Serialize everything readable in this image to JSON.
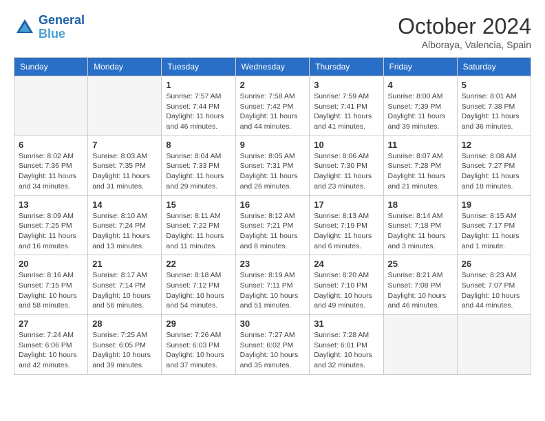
{
  "logo": {
    "line1": "General",
    "line2": "Blue"
  },
  "title": "October 2024",
  "location": "Alboraya, Valencia, Spain",
  "weekdays": [
    "Sunday",
    "Monday",
    "Tuesday",
    "Wednesday",
    "Thursday",
    "Friday",
    "Saturday"
  ],
  "weeks": [
    [
      {
        "day": null
      },
      {
        "day": null
      },
      {
        "day": "1",
        "sunrise": "7:57 AM",
        "sunset": "7:44 PM",
        "daylight": "11 hours and 46 minutes."
      },
      {
        "day": "2",
        "sunrise": "7:58 AM",
        "sunset": "7:42 PM",
        "daylight": "11 hours and 44 minutes."
      },
      {
        "day": "3",
        "sunrise": "7:59 AM",
        "sunset": "7:41 PM",
        "daylight": "11 hours and 41 minutes."
      },
      {
        "day": "4",
        "sunrise": "8:00 AM",
        "sunset": "7:39 PM",
        "daylight": "11 hours and 39 minutes."
      },
      {
        "day": "5",
        "sunrise": "8:01 AM",
        "sunset": "7:38 PM",
        "daylight": "11 hours and 36 minutes."
      }
    ],
    [
      {
        "day": "6",
        "sunrise": "8:02 AM",
        "sunset": "7:36 PM",
        "daylight": "11 hours and 34 minutes."
      },
      {
        "day": "7",
        "sunrise": "8:03 AM",
        "sunset": "7:35 PM",
        "daylight": "11 hours and 31 minutes."
      },
      {
        "day": "8",
        "sunrise": "8:04 AM",
        "sunset": "7:33 PM",
        "daylight": "11 hours and 29 minutes."
      },
      {
        "day": "9",
        "sunrise": "8:05 AM",
        "sunset": "7:31 PM",
        "daylight": "11 hours and 26 minutes."
      },
      {
        "day": "10",
        "sunrise": "8:06 AM",
        "sunset": "7:30 PM",
        "daylight": "11 hours and 23 minutes."
      },
      {
        "day": "11",
        "sunrise": "8:07 AM",
        "sunset": "7:28 PM",
        "daylight": "11 hours and 21 minutes."
      },
      {
        "day": "12",
        "sunrise": "8:08 AM",
        "sunset": "7:27 PM",
        "daylight": "11 hours and 18 minutes."
      }
    ],
    [
      {
        "day": "13",
        "sunrise": "8:09 AM",
        "sunset": "7:25 PM",
        "daylight": "11 hours and 16 minutes."
      },
      {
        "day": "14",
        "sunrise": "8:10 AM",
        "sunset": "7:24 PM",
        "daylight": "11 hours and 13 minutes."
      },
      {
        "day": "15",
        "sunrise": "8:11 AM",
        "sunset": "7:22 PM",
        "daylight": "11 hours and 11 minutes."
      },
      {
        "day": "16",
        "sunrise": "8:12 AM",
        "sunset": "7:21 PM",
        "daylight": "11 hours and 8 minutes."
      },
      {
        "day": "17",
        "sunrise": "8:13 AM",
        "sunset": "7:19 PM",
        "daylight": "11 hours and 6 minutes."
      },
      {
        "day": "18",
        "sunrise": "8:14 AM",
        "sunset": "7:18 PM",
        "daylight": "11 hours and 3 minutes."
      },
      {
        "day": "19",
        "sunrise": "8:15 AM",
        "sunset": "7:17 PM",
        "daylight": "11 hours and 1 minute."
      }
    ],
    [
      {
        "day": "20",
        "sunrise": "8:16 AM",
        "sunset": "7:15 PM",
        "daylight": "10 hours and 58 minutes."
      },
      {
        "day": "21",
        "sunrise": "8:17 AM",
        "sunset": "7:14 PM",
        "daylight": "10 hours and 56 minutes."
      },
      {
        "day": "22",
        "sunrise": "8:18 AM",
        "sunset": "7:12 PM",
        "daylight": "10 hours and 54 minutes."
      },
      {
        "day": "23",
        "sunrise": "8:19 AM",
        "sunset": "7:11 PM",
        "daylight": "10 hours and 51 minutes."
      },
      {
        "day": "24",
        "sunrise": "8:20 AM",
        "sunset": "7:10 PM",
        "daylight": "10 hours and 49 minutes."
      },
      {
        "day": "25",
        "sunrise": "8:21 AM",
        "sunset": "7:08 PM",
        "daylight": "10 hours and 46 minutes."
      },
      {
        "day": "26",
        "sunrise": "8:23 AM",
        "sunset": "7:07 PM",
        "daylight": "10 hours and 44 minutes."
      }
    ],
    [
      {
        "day": "27",
        "sunrise": "7:24 AM",
        "sunset": "6:06 PM",
        "daylight": "10 hours and 42 minutes."
      },
      {
        "day": "28",
        "sunrise": "7:25 AM",
        "sunset": "6:05 PM",
        "daylight": "10 hours and 39 minutes."
      },
      {
        "day": "29",
        "sunrise": "7:26 AM",
        "sunset": "6:03 PM",
        "daylight": "10 hours and 37 minutes."
      },
      {
        "day": "30",
        "sunrise": "7:27 AM",
        "sunset": "6:02 PM",
        "daylight": "10 hours and 35 minutes."
      },
      {
        "day": "31",
        "sunrise": "7:28 AM",
        "sunset": "6:01 PM",
        "daylight": "10 hours and 32 minutes."
      },
      {
        "day": null
      },
      {
        "day": null
      }
    ]
  ]
}
